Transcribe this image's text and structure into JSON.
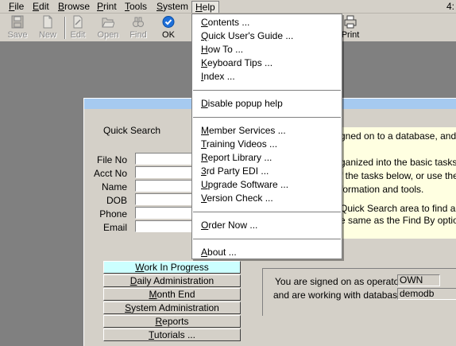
{
  "menubar": {
    "items": [
      {
        "label": "File",
        "ul": "F",
        "rest": "ile"
      },
      {
        "label": "Edit",
        "ul": "E",
        "rest": "dit"
      },
      {
        "label": "Browse",
        "ul": "B",
        "rest": "rowse"
      },
      {
        "label": "Print",
        "ul": "P",
        "rest": "rint"
      },
      {
        "label": "Tools",
        "ul": "T",
        "rest": "ools"
      },
      {
        "label": "System",
        "ul": "S",
        "rest": "ystem"
      },
      {
        "label": "Help",
        "ul": "H",
        "rest": "elp"
      }
    ],
    "corner": "4:"
  },
  "toolbar": {
    "save": "Save",
    "new": "New",
    "edit": "Edit",
    "open": "Open",
    "find": "Find",
    "ok": "OK",
    "print": "Print",
    "colors": {
      "ok_blue": "#1e6fd9",
      "disabled_gray": "#8a8a8a"
    }
  },
  "help_menu": {
    "items": [
      {
        "pre": "",
        "ul": "C",
        "post": "ontents ..."
      },
      {
        "pre": "",
        "ul": "Q",
        "post": "uick User's Guide ..."
      },
      {
        "pre": "",
        "ul": "H",
        "post": "ow To ..."
      },
      {
        "pre": "",
        "ul": "K",
        "post": "eyboard Tips ..."
      },
      {
        "pre": "",
        "ul": "I",
        "post": "ndex ..."
      },
      {
        "pre": "",
        "ul": "D",
        "post": "isable popup help"
      },
      {
        "pre": "",
        "ul": "M",
        "post": "ember Services ..."
      },
      {
        "pre": "",
        "ul": "T",
        "post": "raining Videos ..."
      },
      {
        "pre": "",
        "ul": "R",
        "post": "eport Library ..."
      },
      {
        "pre": "",
        "ul": "3",
        "post": "rd Party EDI ..."
      },
      {
        "pre": "",
        "ul": "U",
        "post": "pgrade Software ..."
      },
      {
        "pre": "",
        "ul": "V",
        "post": "ersion Check ..."
      },
      {
        "pre": "",
        "ul": "O",
        "post": "rder Now ..."
      },
      {
        "pre": "",
        "ul": "A",
        "post": "bout ..."
      }
    ]
  },
  "quick_search": {
    "title": "Quick Search",
    "fields": [
      "File No",
      "Acct No",
      "Name",
      "DOB",
      "Phone",
      "Email"
    ]
  },
  "nav_buttons": [
    {
      "pre": "",
      "ul": "W",
      "post": "ork In Progress",
      "selected": true
    },
    {
      "pre": "",
      "ul": "D",
      "post": "aily Administration",
      "selected": false
    },
    {
      "pre": "",
      "ul": "M",
      "post": "onth End",
      "selected": false
    },
    {
      "pre": "",
      "ul": "S",
      "post": "ystem Administration",
      "selected": false
    },
    {
      "pre": "",
      "ul": "R",
      "post": "eports",
      "selected": false
    },
    {
      "pre": "",
      "ul": "T",
      "post": "utorials ...",
      "selected": false
    }
  ],
  "info_panel": {
    "lines": [
      "gned on to a database, and the",
      "",
      "ganized into the basic tasks yo",
      "f the tasks below, or use the M",
      "formation and tools.",
      "",
      "Quick Search area to find an ac",
      "e same as the Find By options"
    ],
    "bg": "#ffffe1"
  },
  "operator": {
    "signed_as_label": "You are signed on as operator",
    "operator_value": "OWN",
    "database_label": "and are working with database",
    "database_value": "demodb"
  }
}
